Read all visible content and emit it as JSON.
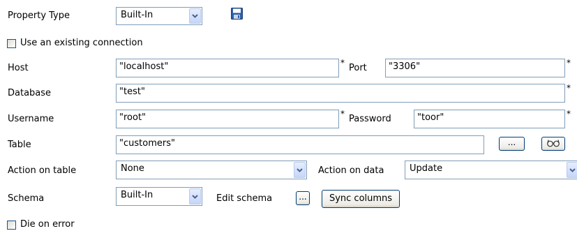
{
  "property_type": {
    "label": "Property Type",
    "value": "Built-In",
    "save_icon": "floppy-disk-icon"
  },
  "use_existing_connection": {
    "label": "Use an existing connection",
    "checked": false
  },
  "host": {
    "label": "Host",
    "value": "\"localhost\""
  },
  "port": {
    "label": "Port",
    "value": "\"3306\""
  },
  "database": {
    "label": "Database",
    "value": "\"test\""
  },
  "username": {
    "label": "Username",
    "value": "\"root\""
  },
  "password": {
    "label": "Password",
    "value": "\"toor\""
  },
  "table": {
    "label": "Table",
    "value": "\"customers\"",
    "browse_label": "...",
    "guess_icon": "glasses-icon"
  },
  "action_on_table": {
    "label": "Action on table",
    "value": "None"
  },
  "action_on_data": {
    "label": "Action on data",
    "value": "Update"
  },
  "schema": {
    "label": "Schema",
    "value": "Built-In",
    "edit_label": "Edit schema",
    "edit_button": "...",
    "sync_label": "Sync columns"
  },
  "die_on_error": {
    "label": "Die on error",
    "checked": false
  },
  "required_marker": "*"
}
